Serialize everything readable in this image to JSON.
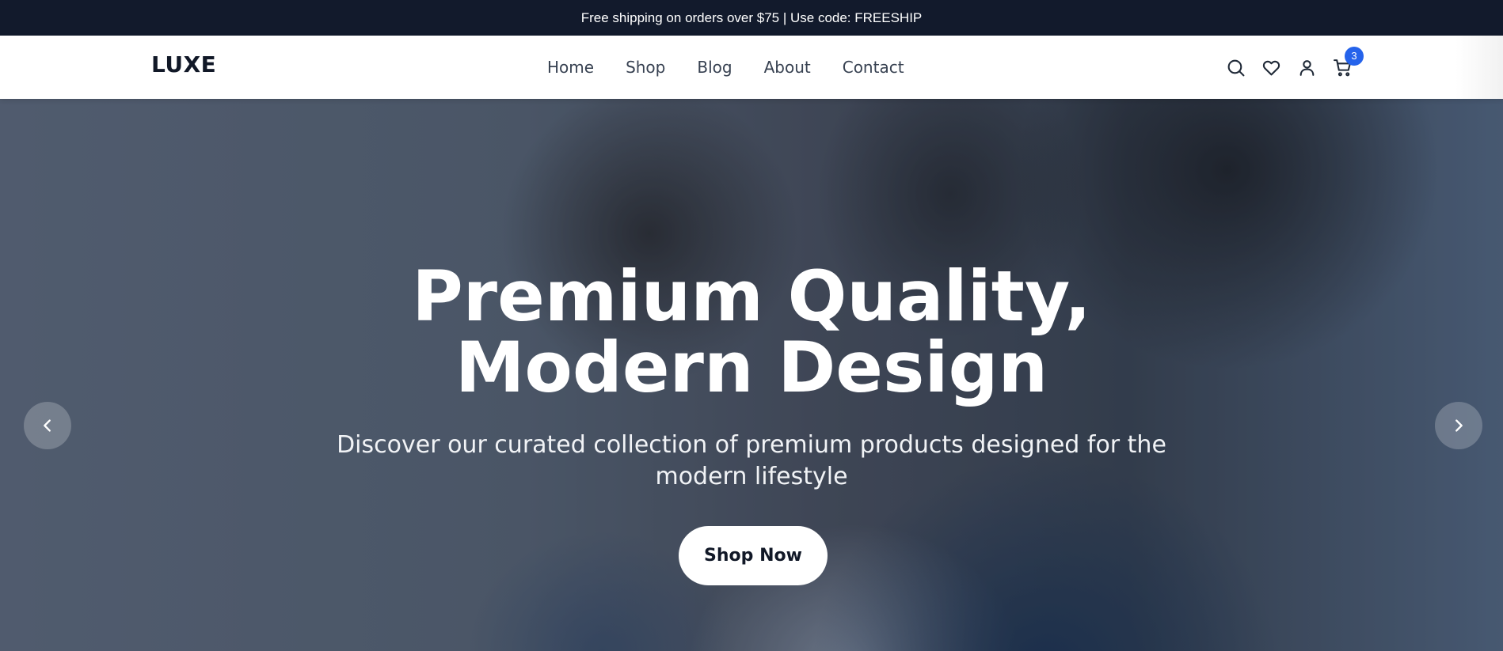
{
  "announcement": {
    "text": "Free shipping on orders over $75 | Use code: FREESHIP"
  },
  "header": {
    "logo": "LUXE",
    "nav": [
      {
        "label": "Home"
      },
      {
        "label": "Shop"
      },
      {
        "label": "Blog"
      },
      {
        "label": "About"
      },
      {
        "label": "Contact"
      }
    ],
    "icons": [
      "search-icon",
      "heart-icon",
      "user-icon",
      "cart-icon"
    ],
    "cart_count": "3"
  },
  "hero": {
    "title_line1": "Premium Quality,",
    "title_line2": "Modern Design",
    "subtitle": "Discover our curated collection of premium products designed for the modern lifestyle",
    "cta_label": "Shop Now",
    "prev_icon": "chevron-left-icon",
    "next_icon": "chevron-right-icon"
  },
  "colors": {
    "announcement_bg": "#121a2c",
    "accent": "#2563eb",
    "text_dark": "#111827",
    "white": "#ffffff"
  }
}
